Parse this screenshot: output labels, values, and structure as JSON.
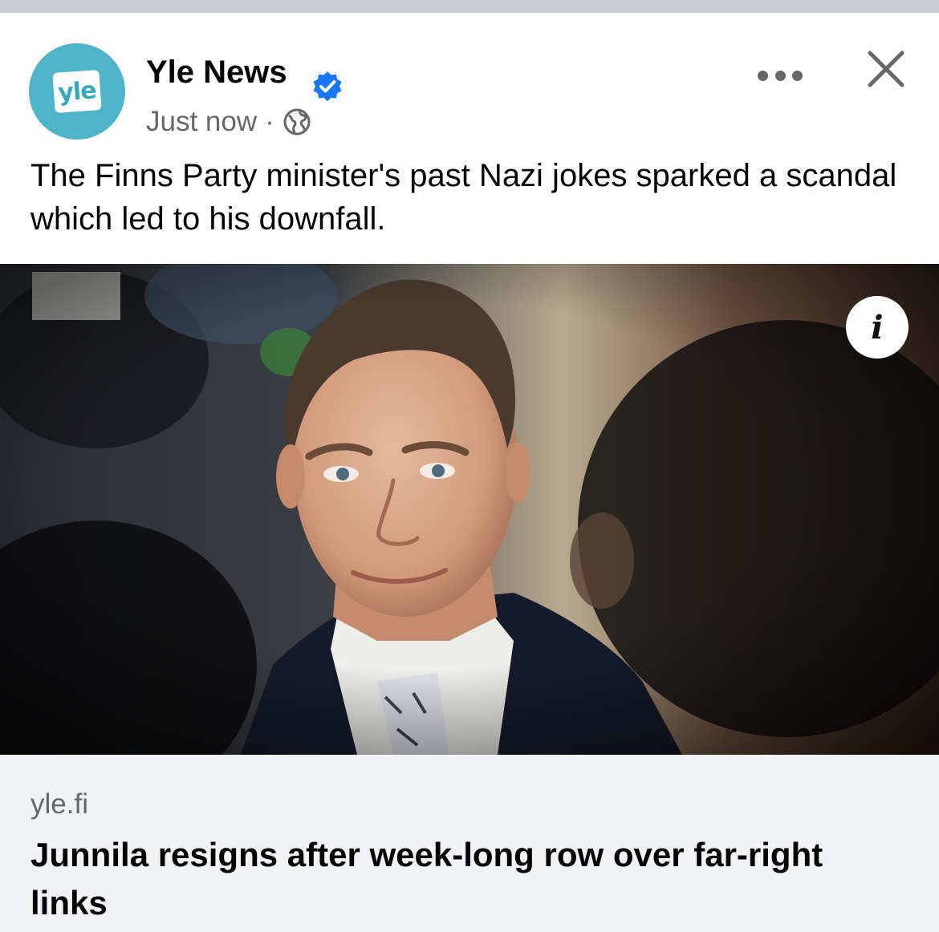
{
  "post": {
    "page_name": "Yle News",
    "avatar_logo_text": "yle",
    "timestamp": "Just now",
    "separator": "·",
    "audience_icon": "globe-icon",
    "verified_icon": "verified-badge-icon",
    "more_icon": "more-options-icon",
    "close_icon": "close-icon",
    "text": "The Finns Party minister's past Nazi jokes sparked a scandal which led to his downfall."
  },
  "image": {
    "info_icon_glyph": "i",
    "info_icon": "info-icon"
  },
  "link": {
    "domain": "yle.fi",
    "title": "Junnila resigns after week-long row over far-right links"
  },
  "colors": {
    "avatar_bg": "#4fb3c9",
    "verified": "#1877f2",
    "secondary_text": "#65676b",
    "link_card_bg": "#f0f2f5"
  }
}
